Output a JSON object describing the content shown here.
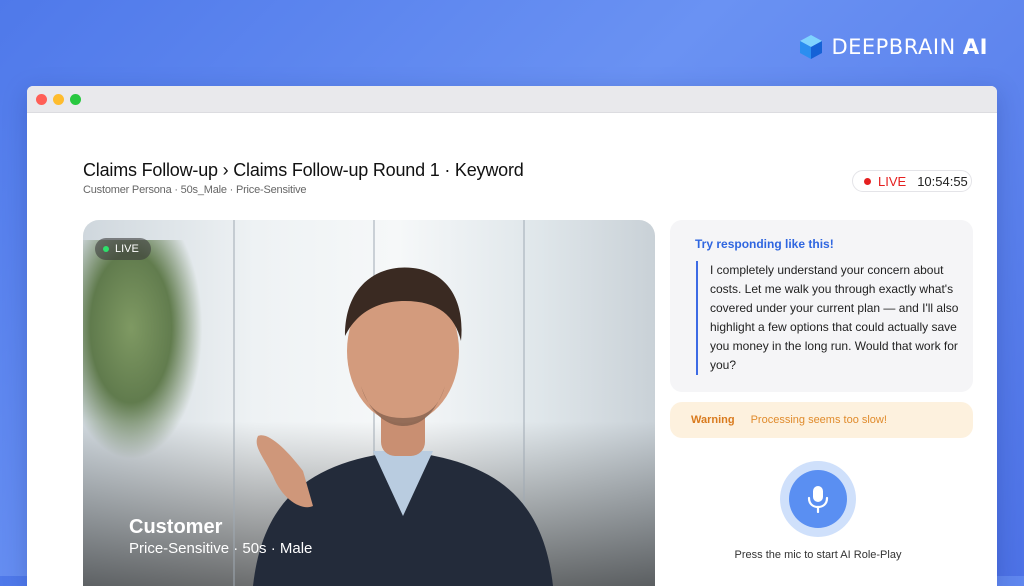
{
  "brand": {
    "name_main": "DEEPBRAIN",
    "name_suffix": "AI",
    "logo_icon": "cube-logo-icon"
  },
  "header": {
    "title": "Claims Follow-up › Claims Follow-up Round 1 · Keyword",
    "subtitle": "Customer Persona · 50s_Male · Price-Sensitive"
  },
  "status": {
    "live_label": "LIVE",
    "time": "10:54:55",
    "live_color": "#e52020"
  },
  "video": {
    "live_badge": "LIVE",
    "caption_name": "Customer",
    "caption_detail": "Price-Sensitive · 50s · Male"
  },
  "suggestion": {
    "title": "Try responding like this!",
    "text": "I completely understand your concern about costs. Let me walk you through exactly what's covered under your current plan — and I'll also highlight a few options that could actually save you money in the long run. Would that work for you?",
    "accent": "#2f66e0"
  },
  "warning": {
    "label": "Warning",
    "message": "Processing seems too slow!",
    "color": "#d97a1d"
  },
  "mic": {
    "icon": "microphone-icon",
    "hint": "Press the mic to start AI Role-Play",
    "color": "#5a8ff2"
  }
}
